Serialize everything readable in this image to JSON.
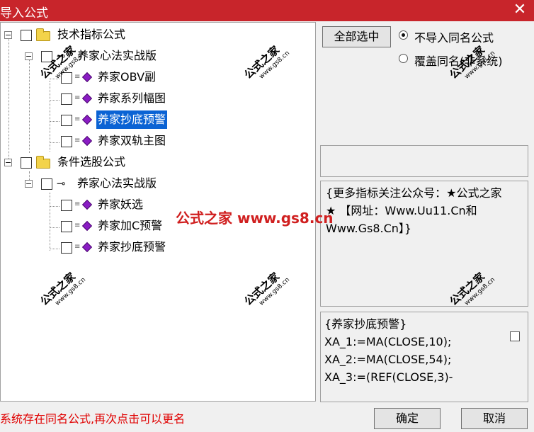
{
  "window": {
    "title": "导入公式",
    "close_icon": "close-icon"
  },
  "tree": {
    "group1": {
      "label": "技术指标公式"
    },
    "group1_child": {
      "label": "养家心法实战版"
    },
    "group1_items": [
      "养家OBV副",
      "养家系列幅图",
      "养家抄底预警",
      "养家双轨主图"
    ],
    "group2": {
      "label": "条件选股公式"
    },
    "group2_child": {
      "label": "养家心法实战版"
    },
    "group2_items": [
      "养家妖选",
      "养家加C预警",
      "养家抄底预警"
    ]
  },
  "options": {
    "select_all": "全部选中",
    "radio1": "不导入同名公式",
    "radio2": "覆盖同名(非系统)",
    "radio1_checked": true
  },
  "description": "{更多指标关注公众号：★公式之家★ 【网址：Www.Uu11.Cn和Www.Gs8.Cn】}",
  "code": {
    "lines": [
      "{养家抄底预警}",
      "XA_1:=MA(CLOSE,10);",
      "XA_2:=MA(CLOSE,54);",
      "XA_3:=(REF(CLOSE,3)-"
    ]
  },
  "status": "系统存在同名公式,再次点击可以更名",
  "buttons": {
    "ok": "确定",
    "cancel": "取消"
  },
  "watermark": {
    "text": "公式之家",
    "url": "www.gs8.cn",
    "center": "公式之家 www.gs8.cn"
  }
}
